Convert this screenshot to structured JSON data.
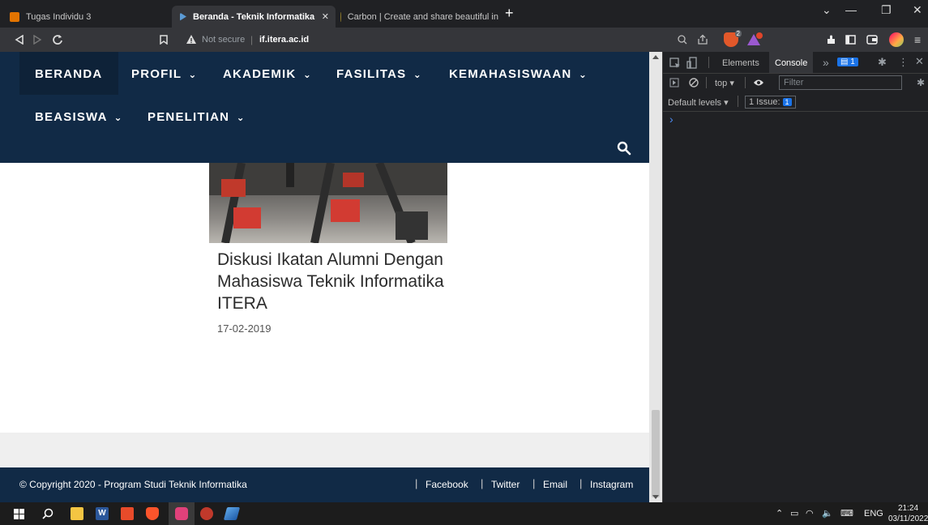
{
  "browser": {
    "tabs": [
      {
        "title": "Tugas Individu 3",
        "favicon_color": "#e37400"
      },
      {
        "title": "Beranda - Teknik Informatika",
        "favicon_color": "#5b9bd5"
      },
      {
        "title": "Carbon | Create and share beautiful in",
        "favicon_color": "#8f7b2b"
      }
    ],
    "close_tab_glyph": "✕",
    "new_tab_glyph": "+",
    "window_buttons": [
      "⌄",
      "—",
      "❐",
      "✕"
    ],
    "address": {
      "security_text": "Not secure",
      "separator": "|",
      "url": "if.itera.ac.id"
    },
    "badge_count": "2"
  },
  "site": {
    "nav_row1": [
      "BERANDA",
      "PROFIL",
      "AKADEMIK",
      "FASILITAS",
      "KEMAHASISWAAN"
    ],
    "nav_row2": [
      "BEASISWA",
      "PENELITIAN"
    ],
    "dropdown_glyph": "⌄",
    "article": {
      "title": "Diskusi Ikatan Alumni Dengan Mahasiswa Teknik Informatika ITERA",
      "date": "17-02-2019"
    },
    "footer": {
      "copyright": "© Copyright 2020 - Program Studi Teknik Informatika",
      "links": [
        "Facebook",
        "Twitter",
        "Email",
        "Instagram"
      ],
      "sep": "|"
    }
  },
  "devtools": {
    "tabs": [
      "Elements",
      "Console"
    ],
    "more_glyph": "»",
    "issues_badge": "1",
    "context": "top",
    "filter_placeholder": "Filter",
    "levels": "Default levels",
    "issues_text": "1 Issue:",
    "issues_count": "1",
    "prompt": "›"
  },
  "taskbar": {
    "language": "ENG",
    "time": "21:24",
    "date": "03/11/2022"
  },
  "colors": {
    "nav_bg": "#112a46",
    "devtools_bg": "#202124",
    "accent": "#1a73e8"
  }
}
